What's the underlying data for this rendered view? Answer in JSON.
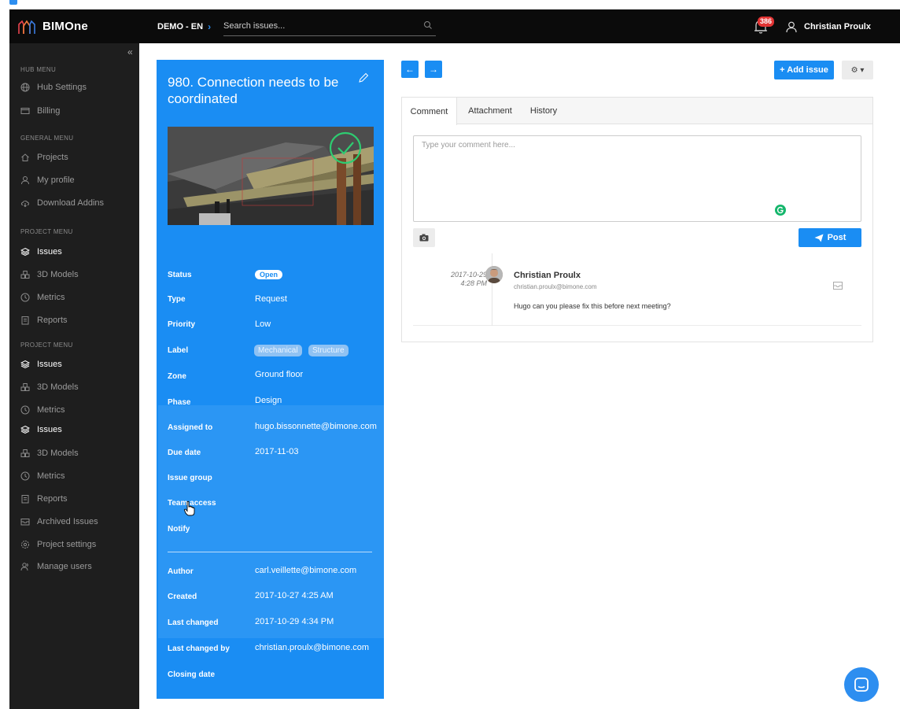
{
  "app": {
    "name": "BIMOne"
  },
  "header": {
    "project": "DEMO - EN",
    "search_placeholder": "Search issues...",
    "notification_count": "386",
    "user_name": "Christian Proulx"
  },
  "sidebar": {
    "collapse_glyph": "«",
    "hub_heading": "HUB MENU",
    "hub_items": [
      {
        "label": "Hub Settings",
        "icon": "globe-icon"
      },
      {
        "label": "Billing",
        "icon": "credit-card-icon"
      }
    ],
    "general_heading": "GENERAL MENU",
    "general_items": [
      {
        "label": "Projects",
        "icon": "home-icon"
      },
      {
        "label": "My profile",
        "icon": "user-icon"
      },
      {
        "label": "Download Addins",
        "icon": "cloud-download-icon"
      }
    ],
    "project_heading_1": "PROJECT MENU",
    "project_items_1": [
      {
        "label": "Issues",
        "icon": "layers-icon"
      },
      {
        "label": "3D Models",
        "icon": "cubes-icon"
      },
      {
        "label": "Metrics",
        "icon": "clock-icon"
      },
      {
        "label": "Reports",
        "icon": "report-icon"
      }
    ],
    "project_heading_2": "PROJECT MENU",
    "project_items_2": [
      {
        "label": "Issues",
        "icon": "layers-icon"
      },
      {
        "label": "3D Models",
        "icon": "cubes-icon"
      },
      {
        "label": "Metrics",
        "icon": "clock-icon"
      },
      {
        "label": "Issues",
        "icon": "layers-icon"
      },
      {
        "label": "3D Models",
        "icon": "cubes-icon"
      },
      {
        "label": "Metrics",
        "icon": "clock-icon"
      },
      {
        "label": "Reports",
        "icon": "report-icon"
      },
      {
        "label": "Archived Issues",
        "icon": "archive-icon"
      },
      {
        "label": "Project settings",
        "icon": "gear-icon"
      },
      {
        "label": "Manage users",
        "icon": "users-icon"
      }
    ]
  },
  "issue": {
    "title": "980. Connection needs to be coordinated",
    "fields": {
      "status_label": "Status",
      "status_value": "Open",
      "type_label": "Type",
      "type_value": "Request",
      "priority_label": "Priority",
      "priority_value": "Low",
      "label_label": "Label",
      "tags": [
        "Mechanical",
        "Structure"
      ],
      "zone_label": "Zone",
      "zone_value": "Ground floor",
      "phase_label": "Phase",
      "phase_value": "Design",
      "assigned_label": "Assigned to",
      "assigned_value": "hugo.bissonnette@bimone.com",
      "due_label": "Due date",
      "due_value": "2017-11-03",
      "group_label": "Issue group",
      "team_label": "Team access",
      "notify_label": "Notify",
      "author_label": "Author",
      "author_value": "carl.veillette@bimone.com",
      "created_label": "Created",
      "created_value": "2017-10-27 4:25 AM",
      "changed_label": "Last changed",
      "changed_value": "2017-10-29 4:34 PM",
      "changed_by_label": "Last changed by",
      "changed_by_value": "christian.proulx@bimone.com",
      "closing_label": "Closing date"
    }
  },
  "toolbar": {
    "prev_glyph": "←",
    "next_glyph": "→",
    "add_issue_label": "+ Add issue",
    "settings_glyph": "⚙ ▾"
  },
  "comments": {
    "tabs": [
      "Comment",
      "Attachment",
      "History"
    ],
    "placeholder": "Type your comment here...",
    "post_label": "Post",
    "entry": {
      "date": "2017-10-29",
      "time": "4:28 PM",
      "author": "Christian Proulx",
      "email": "christian.proulx@bimone.com",
      "text": "Hugo can you  please fix this before next meeting?"
    }
  },
  "colors": {
    "accent": "#1a8df3",
    "topbar": "#0b0b0b",
    "sidebar": "#1e1e1e",
    "badge": "#e23434"
  }
}
